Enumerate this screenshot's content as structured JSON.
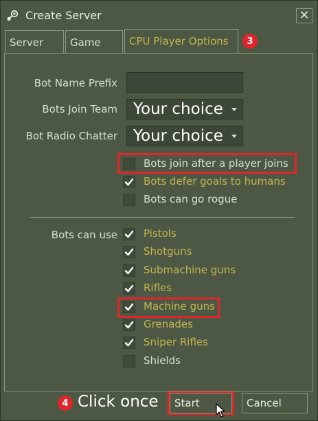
{
  "window": {
    "title": "Create Server",
    "close_glyph": "✕"
  },
  "tabs": [
    {
      "label": "Server",
      "active": false
    },
    {
      "label": "Game",
      "active": false
    },
    {
      "label": "CPU Player Options",
      "active": true
    }
  ],
  "annotations": {
    "step3": "3",
    "step4": "4",
    "step4_text": "Click once"
  },
  "form": {
    "bot_name_prefix": {
      "label": "Bot Name Prefix",
      "value": ""
    },
    "bots_join_team": {
      "label": "Bots Join Team",
      "value": "Your choice"
    },
    "bot_radio_chatter": {
      "label": "Bot Radio Chatter",
      "value": "Your choice"
    }
  },
  "options": [
    {
      "label": "Bots join after a player joins",
      "checked": false
    },
    {
      "label": "Bots defer goals to humans",
      "checked": true
    },
    {
      "label": "Bots can go rogue",
      "checked": false
    }
  ],
  "weapons": {
    "label": "Bots can use",
    "items": [
      {
        "label": "Pistols",
        "checked": true
      },
      {
        "label": "Shotguns",
        "checked": true
      },
      {
        "label": "Submachine guns",
        "checked": true
      },
      {
        "label": "Rifles",
        "checked": true
      },
      {
        "label": "Machine guns",
        "checked": true
      },
      {
        "label": "Grenades",
        "checked": true
      },
      {
        "label": "Sniper Rifles",
        "checked": true
      },
      {
        "label": "Shields",
        "checked": false
      }
    ]
  },
  "buttons": {
    "start": "Start",
    "cancel": "Cancel"
  },
  "colors": {
    "background": "#4c5844",
    "accent_text": "#c4b550",
    "annotation_red": "#e1252a"
  },
  "icons": {
    "app": "steam-icon",
    "close": "close-icon",
    "check": "checkmark-icon",
    "cursor": "mouse-cursor-icon"
  }
}
